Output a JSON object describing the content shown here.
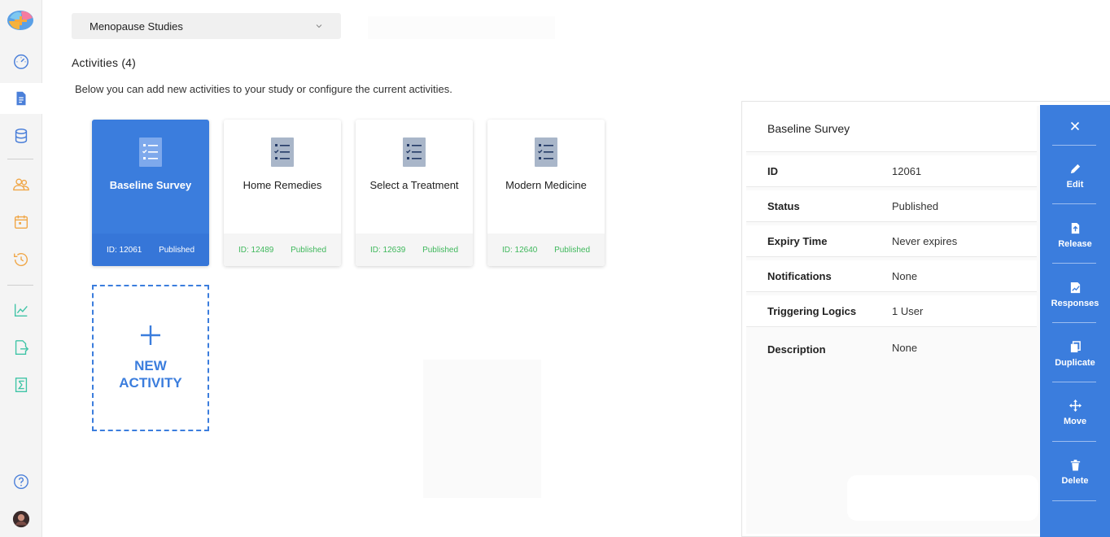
{
  "study_selector": {
    "value": "Menopause Studies"
  },
  "page": {
    "title": "Activities (4)",
    "description": "Below you can add new activities to your study or configure the current activities."
  },
  "activities": [
    {
      "name": "Baseline Survey",
      "id": "ID: 12061",
      "status": "Published",
      "selected": true
    },
    {
      "name": "Home Remedies",
      "id": "ID: 12489",
      "status": "Published",
      "selected": false
    },
    {
      "name": "Select a Treatment",
      "id": "ID: 12639",
      "status": "Published",
      "selected": false
    },
    {
      "name": "Modern Medicine",
      "id": "ID: 12640",
      "status": "Published",
      "selected": false
    }
  ],
  "new_activity": {
    "line1": "NEW",
    "line2": "ACTIVITY"
  },
  "detail": {
    "title": "Baseline Survey",
    "rows": [
      {
        "key": "ID",
        "value": "12061"
      },
      {
        "key": "Status",
        "value": "Published"
      },
      {
        "key": "Expiry Time",
        "value": "Never expires"
      },
      {
        "key": "Notifications",
        "value": "None"
      },
      {
        "key": "Triggering Logics",
        "value": "1 User"
      },
      {
        "key": "Description",
        "value": "None"
      }
    ]
  },
  "actions": {
    "edit": "Edit",
    "release": "Release",
    "responses": "Responses",
    "duplicate": "Duplicate",
    "move": "Move",
    "delete": "Delete"
  },
  "colors": {
    "accent": "#3b7ddd",
    "published_green": "#3fb85c",
    "sidebar_blue": "#4a7fd9",
    "sidebar_orange": "#f0a646",
    "sidebar_teal": "#3fc4a6"
  },
  "icons": {
    "sidebar": [
      "brain-logo",
      "dashboard-gauge-icon",
      "document-icon",
      "database-icon",
      "participants-icon",
      "calendar-icon",
      "history-icon",
      "signature-chart-icon",
      "export-icon",
      "sigma-icon",
      "help-icon",
      "avatar"
    ],
    "card": "checklist-icon"
  }
}
